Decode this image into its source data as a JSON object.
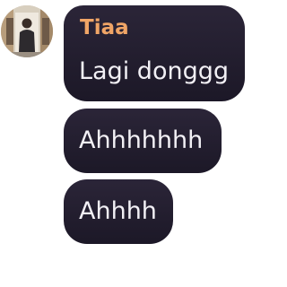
{
  "chat": {
    "avatar_icon": "user-photo",
    "messages": [
      {
        "sender": "Tiaa",
        "text": "Lagi donggg"
      },
      {
        "text": "Ahhhhhhh"
      },
      {
        "text": "Ahhhh"
      }
    ]
  },
  "colors": {
    "bubble": "#231e2f",
    "sender_name": "#f0a566",
    "message_text": "#f2f0f5",
    "background": "#ffffff"
  }
}
